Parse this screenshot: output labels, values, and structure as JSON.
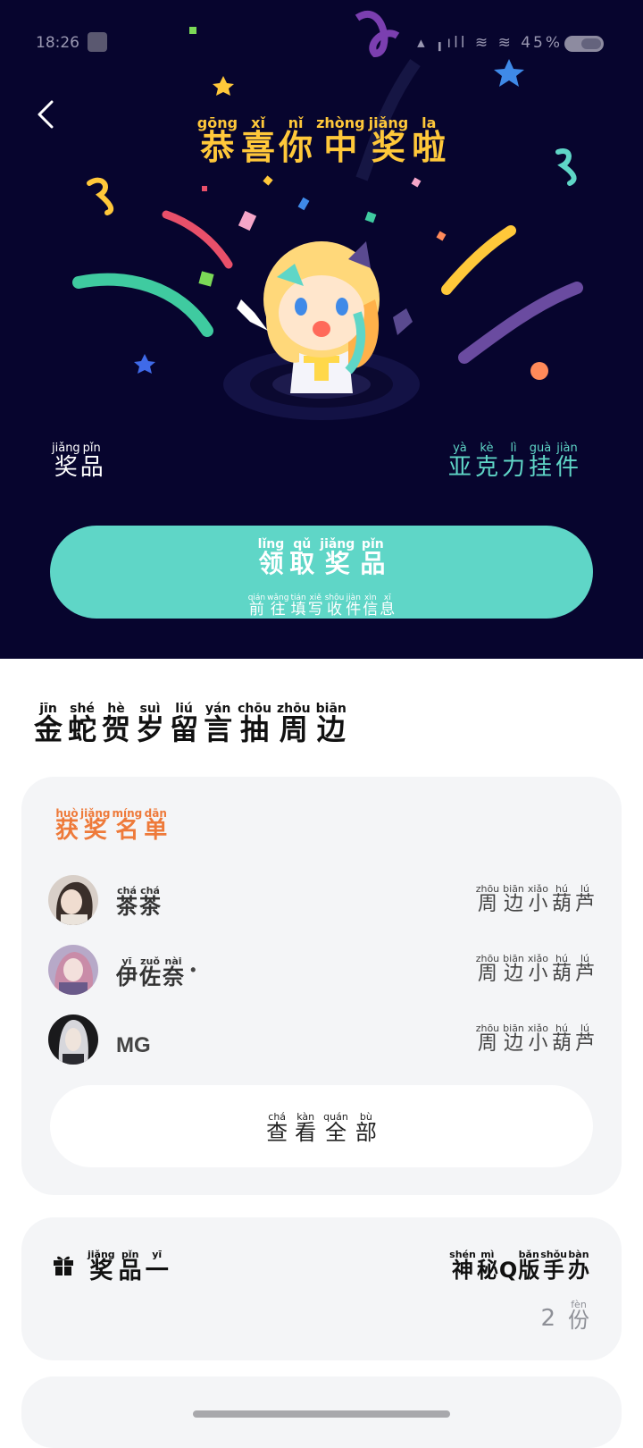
{
  "status_bar": {
    "time": "18:26",
    "signal_text": "▴ ╻ıll ≋ ≋ 45%"
  },
  "header": {
    "back_icon": "chevron-left-icon",
    "congrats": [
      {
        "py": "gōng",
        "hz": "恭"
      },
      {
        "py": "xǐ",
        "hz": "喜"
      },
      {
        "py": "nǐ",
        "hz": "你"
      },
      {
        "py": "zhòng",
        "hz": "中"
      },
      {
        "py": "jiǎng",
        "hz": "奖"
      },
      {
        "py": "la",
        "hz": "啦"
      }
    ]
  },
  "prize": {
    "label": [
      {
        "py": "jiǎng",
        "hz": "奖"
      },
      {
        "py": "pǐn",
        "hz": "品"
      }
    ],
    "value": [
      {
        "py": "yà",
        "hz": "亚"
      },
      {
        "py": "kè",
        "hz": "克"
      },
      {
        "py": "lì",
        "hz": "力"
      },
      {
        "py": "guà",
        "hz": "挂"
      },
      {
        "py": "jiàn",
        "hz": "件"
      }
    ],
    "value_color": "#5fd6c7"
  },
  "claim_button": {
    "main": [
      {
        "py": "lǐng",
        "hz": "领"
      },
      {
        "py": "qǔ",
        "hz": "取"
      },
      {
        "py": "jiǎng",
        "hz": "奖"
      },
      {
        "py": "pǐn",
        "hz": "品"
      }
    ],
    "sub": [
      {
        "py": "qián",
        "hz": "前"
      },
      {
        "py": "wǎng",
        "hz": "往"
      },
      {
        "py": "tián",
        "hz": "填"
      },
      {
        "py": "xiě",
        "hz": "写"
      },
      {
        "py": "shōu",
        "hz": "收"
      },
      {
        "py": "jiàn",
        "hz": "件"
      },
      {
        "py": "xìn",
        "hz": "信"
      },
      {
        "py": "xī",
        "hz": "息"
      }
    ],
    "color": "#5fd6c7"
  },
  "section_title": [
    {
      "py": "jīn",
      "hz": "金"
    },
    {
      "py": "shé",
      "hz": "蛇"
    },
    {
      "py": "hè",
      "hz": "贺"
    },
    {
      "py": "suì",
      "hz": "岁"
    },
    {
      "py": "liú",
      "hz": "留"
    },
    {
      "py": "yán",
      "hz": "言"
    },
    {
      "py": "chōu",
      "hz": "抽"
    },
    {
      "py": "zhōu",
      "hz": "周"
    },
    {
      "py": "biān",
      "hz": "边"
    }
  ],
  "winners": {
    "title": [
      {
        "py": "huò",
        "hz": "获"
      },
      {
        "py": "jiǎng",
        "hz": "奖"
      },
      {
        "py": "míng",
        "hz": "名"
      },
      {
        "py": "dān",
        "hz": "单"
      }
    ],
    "title_color": "#ee7a3a",
    "list": [
      {
        "name": [
          {
            "py": "chá",
            "hz": "茶"
          },
          {
            "py": "chá",
            "hz": "茶"
          }
        ],
        "prize": [
          {
            "py": "zhōu",
            "hz": "周"
          },
          {
            "py": "biān",
            "hz": "边"
          },
          {
            "py": "xiǎo",
            "hz": "小"
          },
          {
            "py": "hú",
            "hz": "葫"
          },
          {
            "py": "lú",
            "hz": "芦"
          }
        ]
      },
      {
        "name": [
          {
            "py": "yī",
            "hz": "伊"
          },
          {
            "py": "zuǒ",
            "hz": "佐"
          },
          {
            "py": "nài",
            "hz": "奈"
          }
        ],
        "name_suffix": "•",
        "prize": [
          {
            "py": "zhōu",
            "hz": "周"
          },
          {
            "py": "biān",
            "hz": "边"
          },
          {
            "py": "xiǎo",
            "hz": "小"
          },
          {
            "py": "hú",
            "hz": "葫"
          },
          {
            "py": "lú",
            "hz": "芦"
          }
        ]
      },
      {
        "name_latin": "MG",
        "prize": [
          {
            "py": "zhōu",
            "hz": "周"
          },
          {
            "py": "biān",
            "hz": "边"
          },
          {
            "py": "xiǎo",
            "hz": "小"
          },
          {
            "py": "hú",
            "hz": "葫"
          },
          {
            "py": "lú",
            "hz": "芦"
          }
        ]
      }
    ],
    "view_all": [
      {
        "py": "chá",
        "hz": "查"
      },
      {
        "py": "kàn",
        "hz": "看"
      },
      {
        "py": "quán",
        "hz": "全"
      },
      {
        "py": "bù",
        "hz": "部"
      }
    ]
  },
  "prize_card": {
    "icon": "gift-icon",
    "title": [
      {
        "py": "jiǎng",
        "hz": "奖"
      },
      {
        "py": "pǐn",
        "hz": "品"
      },
      {
        "py": "yī",
        "hz": "一"
      }
    ],
    "name": [
      {
        "py": "shén",
        "hz": "神"
      },
      {
        "py": "mì",
        "hz": "秘"
      },
      {
        "py": "",
        "hz": "Q"
      },
      {
        "py": "bǎn",
        "hz": "版"
      },
      {
        "py": "shǒu",
        "hz": "手"
      },
      {
        "py": "bàn",
        "hz": "办"
      }
    ],
    "quantity": "2",
    "unit": {
      "py": "fèn",
      "hz": "份"
    }
  }
}
